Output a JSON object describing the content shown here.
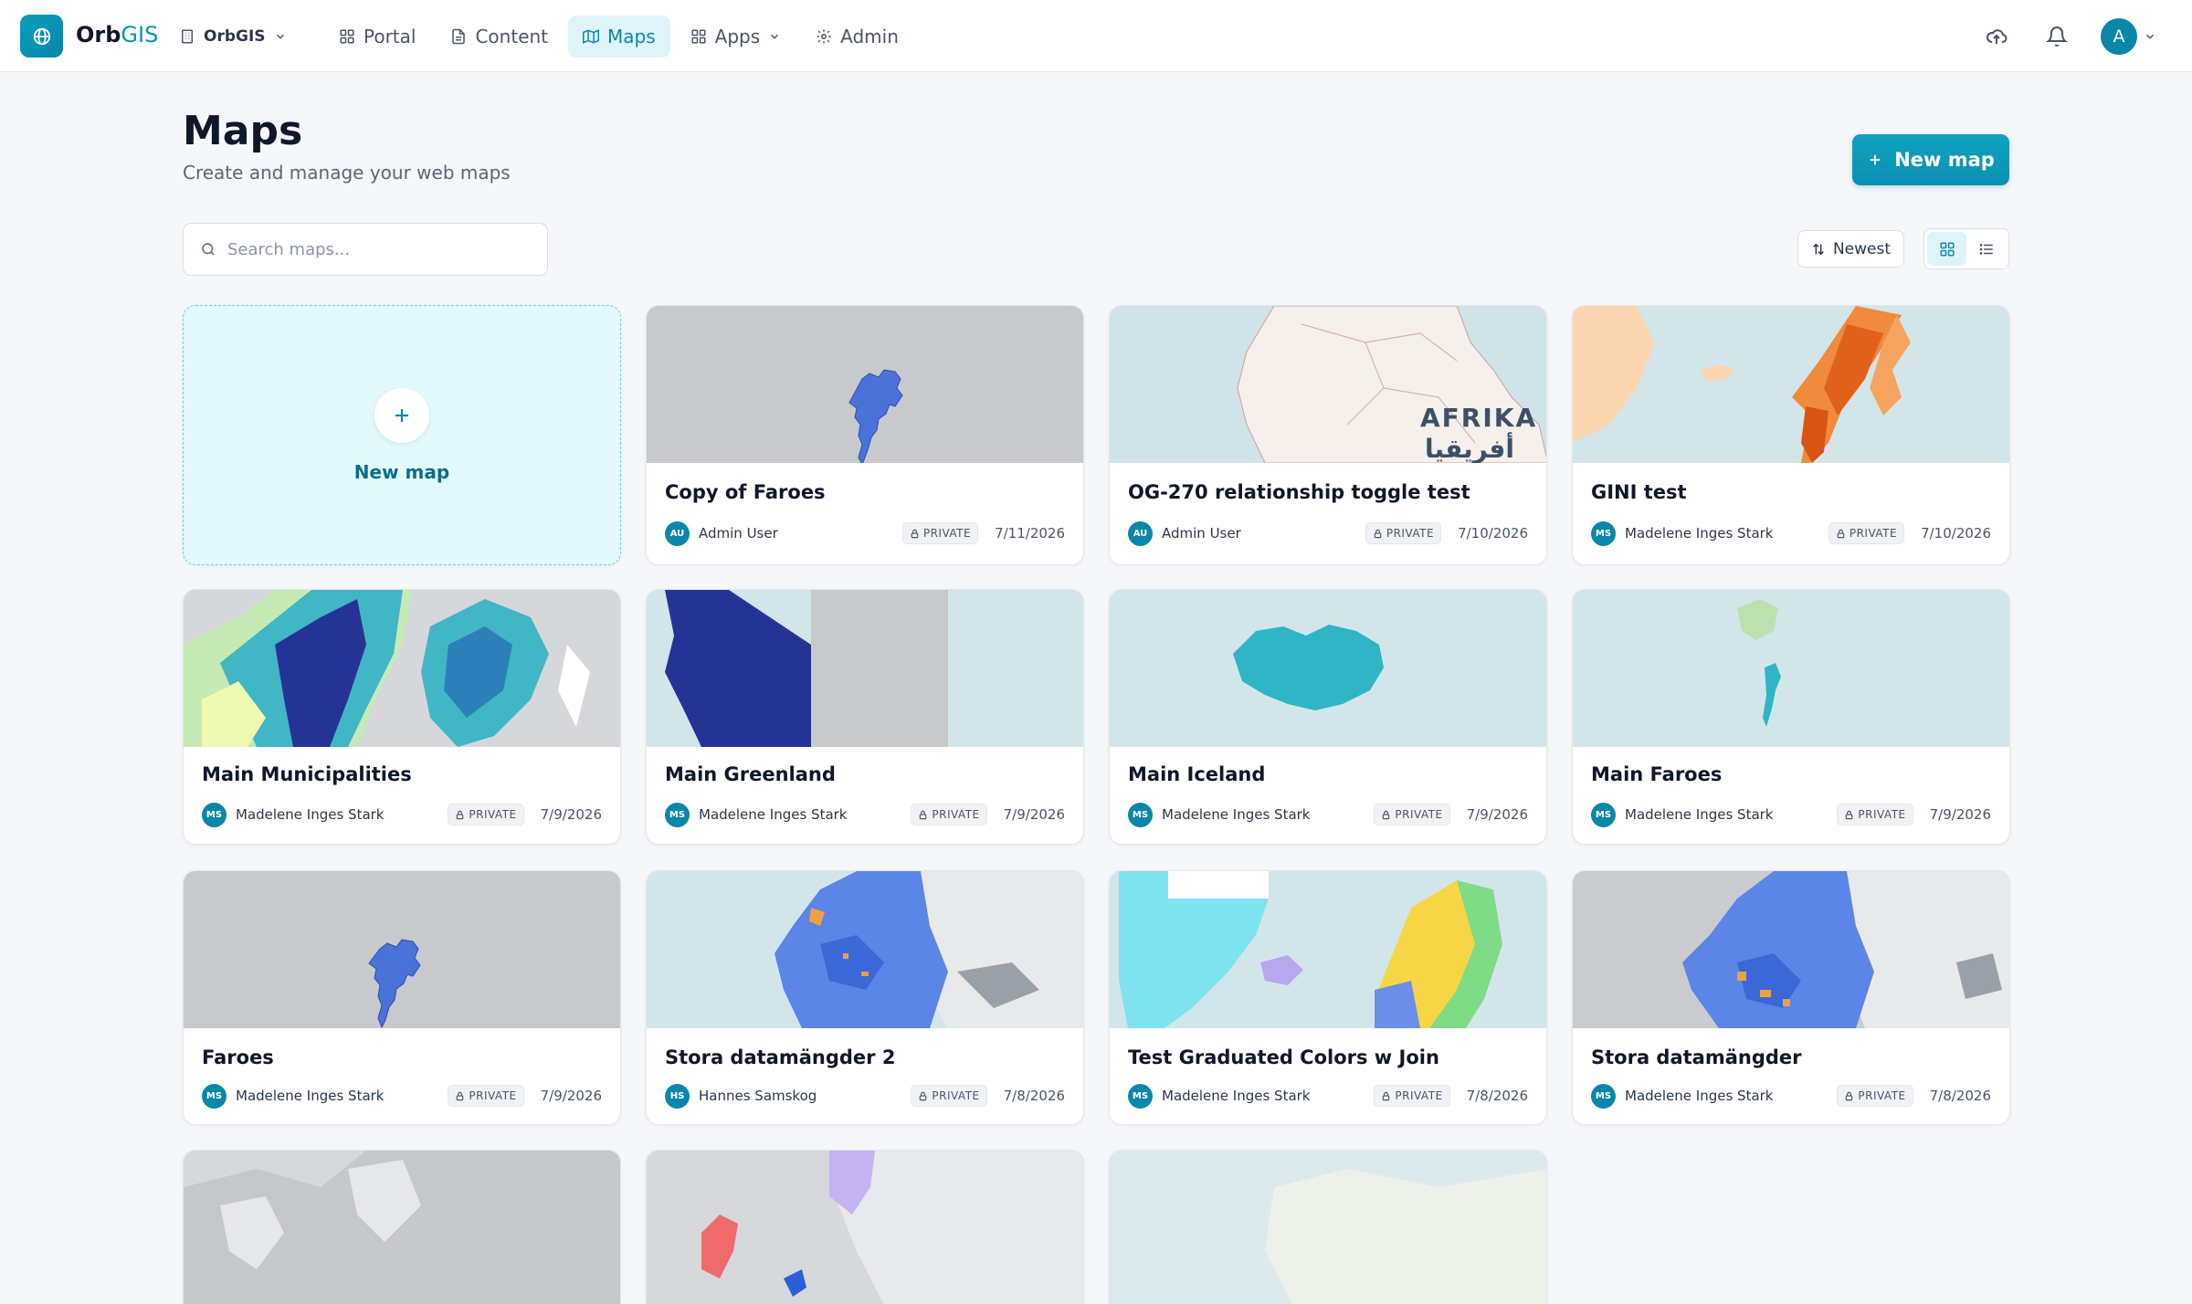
{
  "app": {
    "brand_main": "Orb",
    "brand_accent": "GIS",
    "org": "OrbGIS"
  },
  "nav": [
    {
      "label": "Portal",
      "icon": "grid-icon",
      "active": false
    },
    {
      "label": "Content",
      "icon": "document-icon",
      "active": false
    },
    {
      "label": "Maps",
      "icon": "map-icon",
      "active": true
    },
    {
      "label": "Apps",
      "icon": "apps-icon",
      "active": false
    },
    {
      "label": "Admin",
      "icon": "gear-icon",
      "active": false
    }
  ],
  "user": {
    "avatar_initial": "A"
  },
  "header": {
    "title": "Maps",
    "subtitle": "Create and manage your web maps",
    "new_button": "New map"
  },
  "toolbar": {
    "search_placeholder": "Search maps...",
    "sort_label": "Newest",
    "view_mode": "grid"
  },
  "new_card": {
    "label": "New map"
  },
  "maps": [
    {
      "title": "Copy of Faroes",
      "owner_initials": "AU",
      "owner": "Admin User",
      "visibility": "PRIVATE",
      "date": "7/11/2026",
      "thumb": "faroes-gray"
    },
    {
      "title": "OG-270 relationship toggle test",
      "owner_initials": "AU",
      "owner": "Admin User",
      "visibility": "PRIVATE",
      "date": "7/10/2026",
      "thumb": "afrika",
      "map_label_1": "AFRIKA /",
      "map_label_2": "أفريقيا"
    },
    {
      "title": "GINI test",
      "owner_initials": "MS",
      "owner": "Madelene Inges Stark",
      "visibility": "PRIVATE",
      "date": "7/10/2026",
      "thumb": "gini"
    },
    {
      "title": "Main Municipalities",
      "owner_initials": "MS",
      "owner": "Madelene Inges Stark",
      "visibility": "PRIVATE",
      "date": "7/9/2026",
      "thumb": "municipalities"
    },
    {
      "title": "Main Greenland",
      "owner_initials": "MS",
      "owner": "Madelene Inges Stark",
      "visibility": "PRIVATE",
      "date": "7/9/2026",
      "thumb": "greenland"
    },
    {
      "title": "Main Iceland",
      "owner_initials": "MS",
      "owner": "Madelene Inges Stark",
      "visibility": "PRIVATE",
      "date": "7/9/2026",
      "thumb": "iceland"
    },
    {
      "title": "Main Faroes",
      "owner_initials": "MS",
      "owner": "Madelene Inges Stark",
      "visibility": "PRIVATE",
      "date": "7/9/2026",
      "thumb": "faroes-main"
    },
    {
      "title": "Faroes",
      "owner_initials": "MS",
      "owner": "Madelene Inges Stark",
      "visibility": "PRIVATE",
      "date": "7/9/2026",
      "thumb": "faroes-gray"
    },
    {
      "title": "Stora datamängder 2",
      "owner_initials": "HS",
      "owner": "Hannes Samskog",
      "visibility": "PRIVATE",
      "date": "7/8/2026",
      "thumb": "europe-blue"
    },
    {
      "title": "Test Graduated Colors w Join",
      "owner_initials": "MS",
      "owner": "Madelene Inges Stark",
      "visibility": "PRIVATE",
      "date": "7/8/2026",
      "thumb": "graduated"
    },
    {
      "title": "Stora datamängder",
      "owner_initials": "MS",
      "owner": "Madelene Inges Stark",
      "visibility": "PRIVATE",
      "date": "7/8/2026",
      "thumb": "europe-blue2"
    },
    {
      "title": "",
      "thumb": "europe-gray"
    },
    {
      "title": "",
      "thumb": "scandinavia-purple"
    },
    {
      "title": "",
      "thumb": "light-map"
    }
  ]
}
